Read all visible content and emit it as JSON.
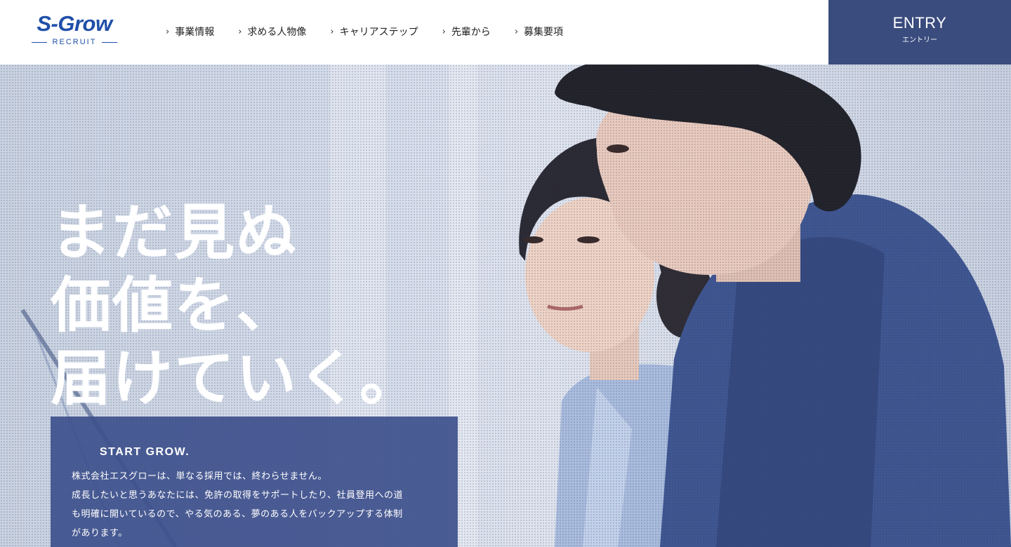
{
  "header": {
    "logo": {
      "main": "S-Grow",
      "sub": "RECRUIT"
    },
    "nav": [
      {
        "label": "事業情報"
      },
      {
        "label": "求める人物像"
      },
      {
        "label": "キャリアステップ"
      },
      {
        "label": "先輩から"
      },
      {
        "label": "募集要項"
      }
    ],
    "entry": {
      "label": "ENTRY",
      "sub": "エントリー"
    }
  },
  "hero": {
    "headline": [
      "まだ見ぬ",
      "価値を、",
      "届けていく。"
    ],
    "box": {
      "title": "START GROW.",
      "lines": [
        "株式会社エスグローは、単なる採用では、終わらせません。",
        "成長したいと思うあなたには、免許の取得をサポートしたり、社員登用への道",
        "も明確に開いているので、やる気のある、夢のある人をバックアップする体制",
        "があります。"
      ]
    }
  },
  "colors": {
    "brand": "#1f4fa8",
    "entry_bg": "#3a4b7d",
    "box_bg": "#3e508c"
  }
}
